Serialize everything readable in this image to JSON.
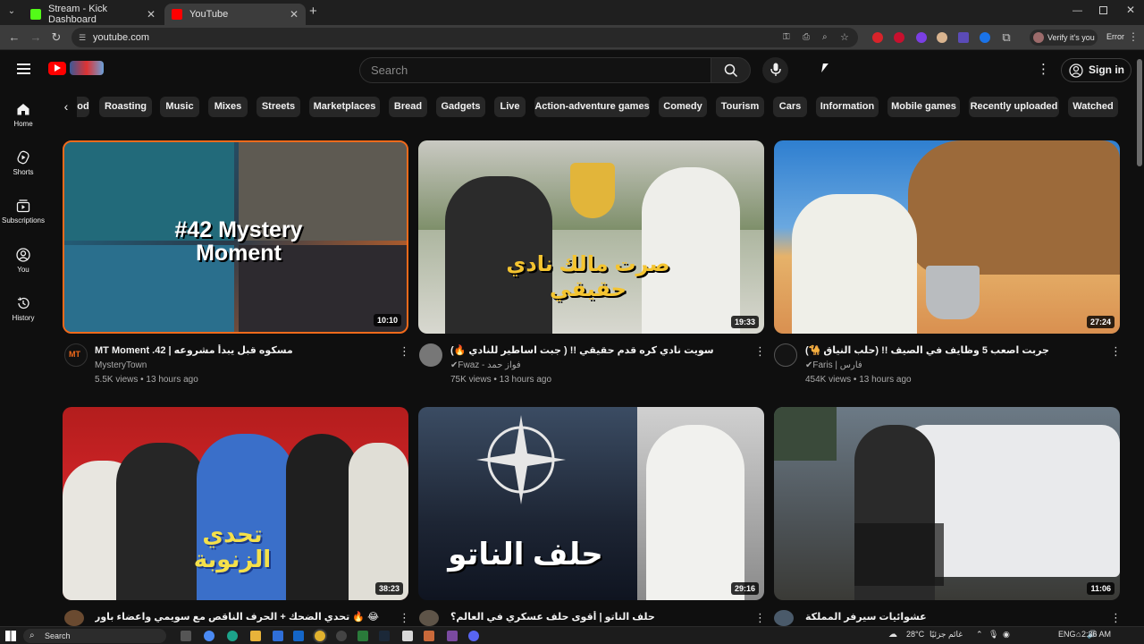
{
  "browser": {
    "tabs": [
      {
        "title": "Stream - Kick Dashboard",
        "favicon_color": "#53fc18"
      },
      {
        "title": "YouTube",
        "favicon_color": "#ff0000"
      }
    ],
    "url": "youtube.com",
    "profile": "Verify it's you",
    "error": "Error"
  },
  "youtube": {
    "search_placeholder": "Search",
    "sign_in": "Sign in",
    "sidebar": [
      {
        "label": "Home",
        "icon": "home-icon"
      },
      {
        "label": "Shorts",
        "icon": "shorts-icon"
      },
      {
        "label": "Subscriptions",
        "icon": "subscriptions-icon"
      },
      {
        "label": "You",
        "icon": "you-icon"
      },
      {
        "label": "History",
        "icon": "history-icon"
      }
    ],
    "chips": [
      "od",
      "Roasting",
      "Music",
      "Mixes",
      "Streets",
      "Marketplaces",
      "Bread",
      "Gadgets",
      "Live",
      "Action-adventure games",
      "Comedy",
      "Tourism",
      "Cars",
      "Information",
      "Mobile games",
      "Recently uploaded",
      "Watched"
    ],
    "videos": [
      {
        "title": "MT Moment .42 | مسكوه قبل يبدأ مشروعه",
        "channel": "MysteryTown",
        "meta": "5.5K views • 13 hours ago",
        "duration": "10:10",
        "thumb_text": "#42 Mystery Moment"
      },
      {
        "title": "سويت نادي كره قدم حقيقي !! ( جبت اساطير للنادي 🔥)",
        "channel": "Fwaz - فواز حمد",
        "meta": "75K views • 13 hours ago",
        "duration": "19:33",
        "thumb_text": "صرت مالك نادي حقيقي"
      },
      {
        "title": "جربت اصعب 5 وظايف في الصيف !! (حلب النياق 🐪)",
        "channel": "Faris | فارس",
        "meta": "454K views • 13 hours ago",
        "duration": "27:24",
        "thumb_text": ""
      },
      {
        "title": "تحدي الضحك + الحرف الناقص مع سويمي واعضاء باور 🔥 😂",
        "channel": "",
        "meta": "",
        "duration": "38:23",
        "thumb_text": "تحدي الزنوبة"
      },
      {
        "title": "حلف الناتو | أقوى حلف عسكري في العالم؟",
        "channel": "",
        "meta": "",
        "duration": "29:16",
        "thumb_text": "حلف الناتو"
      },
      {
        "title": "عشوائيات سيرفر المملكة",
        "channel": "",
        "meta": "",
        "duration": "11:06",
        "thumb_text": ""
      }
    ]
  },
  "taskbar": {
    "search": "Search",
    "weather": "28°C",
    "weather_desc": "غائم جزئيًا",
    "lang": "ENG",
    "time": "2:36 AM"
  }
}
